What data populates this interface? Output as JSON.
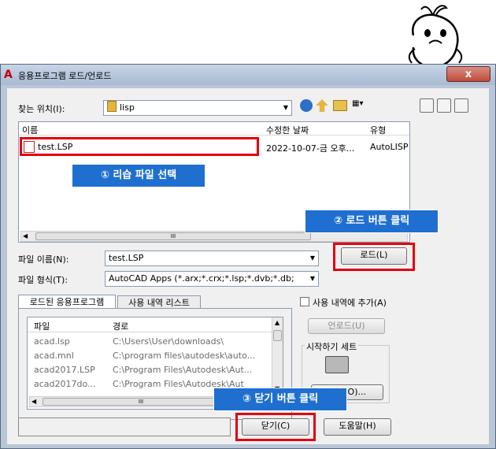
{
  "dialog": {
    "title": "응용프로그램 로드/언로드",
    "close_label": "x"
  },
  "look_in": {
    "label": "찾는 위치(I):",
    "value": "lisp"
  },
  "file_list": {
    "columns": [
      "이름",
      "수정한 날짜",
      "유형"
    ],
    "rows": [
      {
        "name": "test.LSP",
        "date": "2022-10-07-금 오후...",
        "type": "AutoLISP"
      }
    ]
  },
  "file_name": {
    "label": "파일 이름(N):",
    "value": "test.LSP"
  },
  "file_type": {
    "label": "파일 형식(T):",
    "value": "AutoCAD Apps (*.arx;*.crx;*.lsp;*.dvb;*.db;"
  },
  "buttons": {
    "load": "로드(L)",
    "unload": "언로드(U)",
    "contents": "내용(O)...",
    "close": "닫기(C)",
    "help": "도움말(H)"
  },
  "tabs": [
    "로드된 응용프로그램",
    "사용 내역 리스트"
  ],
  "history_checkbox": "사용 내역에 추가(A)",
  "startup_suite": "시작하기 세트",
  "loaded_list": {
    "columns": [
      "파일",
      "경로"
    ],
    "rows": [
      {
        "file": "acad.lsp",
        "path": "C:\\Users\\User\\downloads\\"
      },
      {
        "file": "acad.mnl",
        "path": "C:\\program files\\autodesk\\auto..."
      },
      {
        "file": "acad2017.LSP",
        "path": "C:\\Program Files\\Autodesk\\Aut..."
      },
      {
        "file": "acad2017do...",
        "path": "C:\\Program Files\\Autodesk\\Aut"
      }
    ]
  },
  "scroll_grip": "III",
  "callouts": {
    "step1": "① 리습 파일 선택",
    "step2": "② 로드 버튼 클릭",
    "step3": "③ 닫기 버튼 클릭"
  },
  "colors": {
    "highlight_red": "#e2000f",
    "callout_blue": "#1f6fd0"
  }
}
